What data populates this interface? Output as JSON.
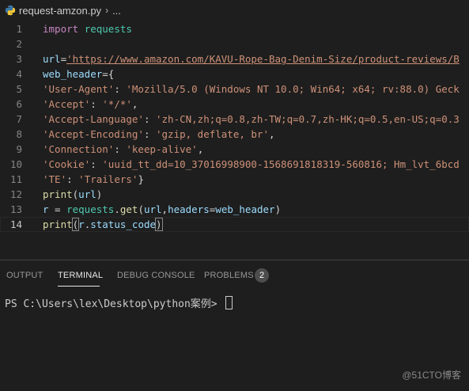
{
  "breadcrumb": {
    "file": "request-amzon.py",
    "ellipsis": "..."
  },
  "editor": {
    "active_line": 14,
    "lines": [
      {
        "n": "1",
        "tokens": [
          {
            "t": "import",
            "c": "kw"
          },
          {
            "t": " "
          },
          {
            "t": "requests",
            "c": "mod"
          }
        ]
      },
      {
        "n": "2",
        "tokens": []
      },
      {
        "n": "3",
        "tokens": [
          {
            "t": "url",
            "c": "var"
          },
          {
            "t": "="
          },
          {
            "t": "'https://www.amazon.com/KAVU-Rope-Bag-Denim-Size/product-reviews/B",
            "c": "url"
          }
        ]
      },
      {
        "n": "4",
        "tokens": [
          {
            "t": "web_header",
            "c": "var"
          },
          {
            "t": "={"
          }
        ]
      },
      {
        "n": "5",
        "tokens": [
          {
            "t": "'User-Agent'",
            "c": "str"
          },
          {
            "t": ": "
          },
          {
            "t": "'Mozilla/5.0 (Windows NT 10.0; Win64; x64; rv:88.0) Geck",
            "c": "str"
          }
        ]
      },
      {
        "n": "6",
        "tokens": [
          {
            "t": "'Accept'",
            "c": "str"
          },
          {
            "t": ": "
          },
          {
            "t": "'*/*'",
            "c": "str"
          },
          {
            "t": ","
          }
        ]
      },
      {
        "n": "7",
        "tokens": [
          {
            "t": "'Accept-Language'",
            "c": "str"
          },
          {
            "t": ": "
          },
          {
            "t": "'zh-CN,zh;q=0.8,zh-TW;q=0.7,zh-HK;q=0.5,en-US;q=0.3",
            "c": "str"
          }
        ]
      },
      {
        "n": "8",
        "tokens": [
          {
            "t": "'Accept-Encoding'",
            "c": "str"
          },
          {
            "t": ": "
          },
          {
            "t": "'gzip, deflate, br'",
            "c": "str"
          },
          {
            "t": ","
          }
        ]
      },
      {
        "n": "9",
        "tokens": [
          {
            "t": "'Connection'",
            "c": "str"
          },
          {
            "t": ": "
          },
          {
            "t": "'keep-alive'",
            "c": "str"
          },
          {
            "t": ","
          }
        ]
      },
      {
        "n": "10",
        "tokens": [
          {
            "t": "'Cookie'",
            "c": "str"
          },
          {
            "t": ": "
          },
          {
            "t": "'uuid_tt_dd=10_37016998900-1568691818319-560816; Hm_lvt_6bcd",
            "c": "str"
          }
        ]
      },
      {
        "n": "11",
        "tokens": [
          {
            "t": "'TE'",
            "c": "str"
          },
          {
            "t": ": "
          },
          {
            "t": "'Trailers'",
            "c": "str"
          },
          {
            "t": "}"
          }
        ]
      },
      {
        "n": "12",
        "tokens": [
          {
            "t": "print",
            "c": "fn"
          },
          {
            "t": "("
          },
          {
            "t": "url",
            "c": "var"
          },
          {
            "t": ")"
          }
        ]
      },
      {
        "n": "13",
        "tokens": [
          {
            "t": "r",
            "c": "var"
          },
          {
            "t": " = "
          },
          {
            "t": "requests",
            "c": "mod"
          },
          {
            "t": "."
          },
          {
            "t": "get",
            "c": "fn"
          },
          {
            "t": "("
          },
          {
            "t": "url",
            "c": "var"
          },
          {
            "t": ","
          },
          {
            "t": "headers",
            "c": "var"
          },
          {
            "t": "="
          },
          {
            "t": "web_header",
            "c": "var"
          },
          {
            "t": ")"
          }
        ]
      },
      {
        "n": "14",
        "tokens": [
          {
            "t": "print",
            "c": "fn"
          },
          {
            "t": "(",
            "c": "brk"
          },
          {
            "t": "r",
            "c": "var"
          },
          {
            "t": "."
          },
          {
            "t": "status_code",
            "c": "var"
          },
          {
            "t": ")",
            "c": "brk"
          }
        ]
      }
    ]
  },
  "panel": {
    "tabs": {
      "output": "OUTPUT",
      "terminal": "TERMINAL",
      "debug_console": "DEBUG CONSOLE",
      "problems": "PROBLEMS",
      "problems_count": "2"
    },
    "terminal_prompt": "PS C:\\Users\\lex\\Desktop\\python案例> "
  },
  "watermark": "@51CTO博客",
  "colors": {
    "background": "#1e1e1e",
    "keyword": "#c586c0",
    "module": "#4ec9b0",
    "variable": "#9cdcfe",
    "string": "#ce9178",
    "function": "#dcdcaa"
  }
}
